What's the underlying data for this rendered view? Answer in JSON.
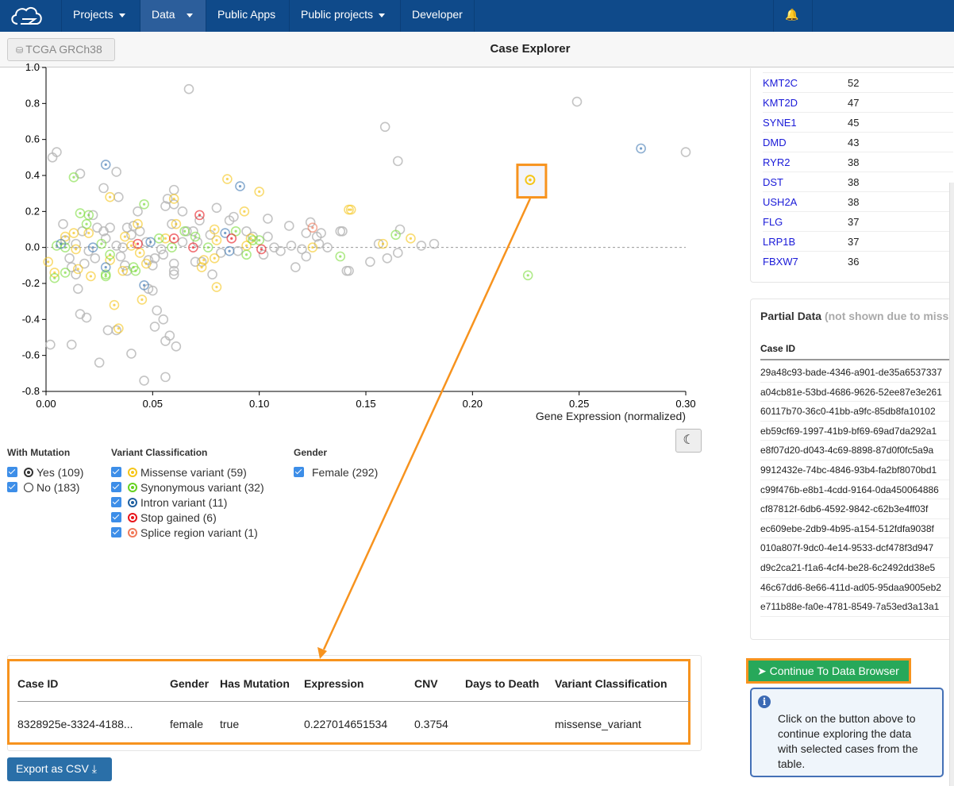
{
  "nav": {
    "items": [
      {
        "label": "Projects",
        "dropdown": true
      },
      {
        "label": "Data",
        "dropdown": true,
        "active": true
      },
      {
        "label": "Public Apps",
        "dropdown": false
      },
      {
        "label": "Public projects",
        "dropdown": true
      },
      {
        "label": "Developer",
        "dropdown": false
      }
    ],
    "bell_icon": "bell-icon"
  },
  "subheader": {
    "dataset_button": "TCGA GRCh38",
    "title": "Case Explorer"
  },
  "colors": {
    "nav_bg": "#0f4a8a",
    "highlight": "#f7931e",
    "continue": "#27a85a",
    "none": "#b5b5b5",
    "missense_variant": "#f5c518",
    "synonymous_variant": "#7bdc3c",
    "intron_variant": "#3f78b3",
    "stop_gained": "#e8141a",
    "splice_region_variant": "#f07a5a"
  },
  "chart_data": {
    "type": "scatter",
    "xlabel": "Gene Expression (normalized)",
    "xlim": [
      0,
      0.3
    ],
    "ylim": [
      -0.8,
      1.0
    ],
    "xticks": [
      "0.00",
      "0.05",
      "0.10",
      "0.15",
      "0.20",
      "0.25",
      "0.30"
    ],
    "yticks": [
      "-0.8",
      "-0.6",
      "-0.4",
      "-0.2",
      "0.0",
      "0.2",
      "0.4",
      "0.6",
      "0.8",
      "1.0"
    ],
    "reference_line_y": 0,
    "grid": false,
    "selected": {
      "x": 0.227014651534,
      "y": 0.3754,
      "class": "missense_variant"
    },
    "points": [
      [
        0.067,
        0.88,
        "none"
      ],
      [
        0.003,
        0.5,
        "none"
      ],
      [
        0.005,
        0.53,
        "none"
      ],
      [
        0.016,
        0.41,
        "none"
      ],
      [
        0.033,
        0.42,
        "none"
      ],
      [
        0.027,
        0.33,
        "none"
      ],
      [
        0.034,
        0.28,
        "none"
      ],
      [
        0.06,
        0.32,
        "none"
      ],
      [
        0.057,
        0.27,
        "none"
      ],
      [
        0.056,
        0.23,
        "none"
      ],
      [
        0.06,
        0.24,
        "none"
      ],
      [
        0.064,
        0.2,
        "none"
      ],
      [
        0.043,
        0.2,
        "none"
      ],
      [
        0.08,
        0.22,
        "none"
      ],
      [
        0.022,
        0.18,
        "none"
      ],
      [
        0.008,
        0.13,
        "none"
      ],
      [
        0.104,
        0.16,
        "none"
      ],
      [
        0.088,
        0.17,
        "none"
      ],
      [
        0.086,
        0.15,
        "none"
      ],
      [
        0.114,
        0.12,
        "none"
      ],
      [
        0.124,
        0.14,
        "none"
      ],
      [
        0.122,
        0.08,
        "none"
      ],
      [
        0.129,
        0.08,
        "none"
      ],
      [
        0.127,
        0.06,
        "none"
      ],
      [
        0.138,
        0.09,
        "none"
      ],
      [
        0.132,
        0.0,
        "none"
      ],
      [
        0.128,
        0.02,
        "none"
      ],
      [
        0.122,
        -0.05,
        "none"
      ],
      [
        0.117,
        -0.11,
        "none"
      ],
      [
        0.141,
        -0.13,
        "none"
      ],
      [
        0.12,
        -0.01,
        "none"
      ],
      [
        0.11,
        -0.02,
        "none"
      ],
      [
        0.115,
        0.01,
        "none"
      ],
      [
        0.107,
        0.0,
        "none"
      ],
      [
        0.104,
        0.06,
        "none"
      ],
      [
        0.102,
        -0.04,
        "none"
      ],
      [
        0.09,
        -0.02,
        "none"
      ],
      [
        0.078,
        -0.15,
        "none"
      ],
      [
        0.073,
        -0.08,
        "none"
      ],
      [
        0.07,
        -0.08,
        "none"
      ],
      [
        0.072,
        0.15,
        "none"
      ],
      [
        0.077,
        0.07,
        "none"
      ],
      [
        0.059,
        0.13,
        "none"
      ],
      [
        0.069,
        0.09,
        "none"
      ],
      [
        0.064,
        0.03,
        "none"
      ],
      [
        0.054,
        -0.01,
        "none"
      ],
      [
        0.055,
        -0.04,
        "none"
      ],
      [
        0.051,
        -0.06,
        "none"
      ],
      [
        0.05,
        -0.1,
        "none"
      ],
      [
        0.06,
        -0.09,
        "none"
      ],
      [
        0.06,
        -0.13,
        "none"
      ],
      [
        0.06,
        -0.15,
        "none"
      ],
      [
        0.048,
        -0.07,
        "none"
      ],
      [
        0.048,
        -0.23,
        "none"
      ],
      [
        0.05,
        -0.24,
        "none"
      ],
      [
        0.052,
        -0.35,
        "none"
      ],
      [
        0.055,
        -0.4,
        "none"
      ],
      [
        0.051,
        -0.44,
        "none"
      ],
      [
        0.058,
        -0.49,
        "none"
      ],
      [
        0.056,
        -0.52,
        "none"
      ],
      [
        0.061,
        -0.55,
        "none"
      ],
      [
        0.056,
        -0.72,
        "none"
      ],
      [
        0.046,
        -0.74,
        "none"
      ],
      [
        0.04,
        -0.59,
        "none"
      ],
      [
        0.025,
        -0.64,
        "none"
      ],
      [
        0.012,
        -0.54,
        "none"
      ],
      [
        0.002,
        -0.54,
        "none"
      ],
      [
        0.029,
        -0.46,
        "none"
      ],
      [
        0.033,
        -0.46,
        "none"
      ],
      [
        0.016,
        -0.37,
        "none"
      ],
      [
        0.019,
        -0.39,
        "none"
      ],
      [
        0.015,
        -0.23,
        "none"
      ],
      [
        0.012,
        -0.11,
        "none"
      ],
      [
        0.014,
        -0.15,
        "none"
      ],
      [
        0.011,
        -0.06,
        "none"
      ],
      [
        0.018,
        -0.09,
        "none"
      ],
      [
        0.017,
        0.09,
        "none"
      ],
      [
        0.024,
        0.11,
        "none"
      ],
      [
        0.027,
        0.09,
        "none"
      ],
      [
        0.03,
        0.11,
        "none"
      ],
      [
        0.028,
        0.05,
        "none"
      ],
      [
        0.038,
        0.11,
        "none"
      ],
      [
        0.041,
        0.12,
        "none"
      ],
      [
        0.04,
        0.07,
        "none"
      ],
      [
        0.044,
        0.09,
        "none"
      ],
      [
        0.033,
        0.01,
        "none"
      ],
      [
        0.036,
        0.0,
        "none"
      ],
      [
        0.035,
        -0.05,
        "none"
      ],
      [
        0.037,
        -0.1,
        "none"
      ],
      [
        0.038,
        -0.13,
        "none"
      ],
      [
        0.023,
        -0.06,
        "none"
      ],
      [
        0.02,
        -0.02,
        "none"
      ],
      [
        0.014,
        0.02,
        "none"
      ],
      [
        0.009,
        0.04,
        "none"
      ],
      [
        0.047,
        0.03,
        "none"
      ],
      [
        0.066,
        0.09,
        "none"
      ],
      [
        0.071,
        0.03,
        "none"
      ],
      [
        0.082,
        -0.03,
        "none"
      ],
      [
        0.097,
        0.06,
        "none"
      ],
      [
        0.094,
        0.09,
        "none"
      ],
      [
        0.249,
        0.81,
        "none"
      ],
      [
        0.159,
        0.67,
        "none"
      ],
      [
        0.165,
        0.48,
        "none"
      ],
      [
        0.3,
        0.53,
        "none"
      ],
      [
        0.139,
        0.09,
        "none"
      ],
      [
        0.166,
        0.1,
        "none"
      ],
      [
        0.156,
        0.02,
        "none"
      ],
      [
        0.176,
        0.01,
        "none"
      ],
      [
        0.182,
        0.02,
        "none"
      ],
      [
        0.165,
        -0.03,
        "none"
      ],
      [
        0.16,
        -0.06,
        "none"
      ],
      [
        0.152,
        -0.08,
        "none"
      ],
      [
        0.142,
        -0.13,
        "none"
      ],
      [
        0.085,
        0.38,
        "missense_variant"
      ],
      [
        0.1,
        0.31,
        "missense_variant"
      ],
      [
        0.093,
        0.2,
        "missense_variant"
      ],
      [
        0.142,
        0.21,
        "missense_variant"
      ],
      [
        0.03,
        0.28,
        "missense_variant"
      ],
      [
        0.06,
        0.27,
        "missense_variant"
      ],
      [
        0.061,
        0.13,
        "missense_variant"
      ],
      [
        0.043,
        0.13,
        "missense_variant"
      ],
      [
        0.013,
        0.08,
        "missense_variant"
      ],
      [
        0.009,
        0.06,
        "missense_variant"
      ],
      [
        0.02,
        0.08,
        "missense_variant"
      ],
      [
        0.037,
        0.06,
        "missense_variant"
      ],
      [
        0.056,
        0.05,
        "missense_variant"
      ],
      [
        0.079,
        0.1,
        "missense_variant"
      ],
      [
        0.08,
        0.04,
        "missense_variant"
      ],
      [
        0.001,
        -0.08,
        "missense_variant"
      ],
      [
        0.004,
        -0.14,
        "missense_variant"
      ],
      [
        0.021,
        -0.16,
        "missense_variant"
      ],
      [
        0.015,
        -0.12,
        "missense_variant"
      ],
      [
        0.032,
        -0.32,
        "missense_variant"
      ],
      [
        0.034,
        -0.45,
        "missense_variant"
      ],
      [
        0.045,
        -0.29,
        "missense_variant"
      ],
      [
        0.047,
        -0.09,
        "missense_variant"
      ],
      [
        0.044,
        -0.03,
        "missense_variant"
      ],
      [
        0.073,
        -0.11,
        "missense_variant"
      ],
      [
        0.08,
        -0.22,
        "missense_variant"
      ],
      [
        0.079,
        -0.06,
        "missense_variant"
      ],
      [
        0.094,
        0.01,
        "missense_variant"
      ],
      [
        0.125,
        0.0,
        "missense_variant"
      ],
      [
        0.014,
        -0.01,
        "missense_variant"
      ],
      [
        0.04,
        0.01,
        "missense_variant"
      ],
      [
        0.096,
        0.05,
        "missense_variant"
      ],
      [
        0.074,
        -0.07,
        "missense_variant"
      ],
      [
        0.03,
        -0.07,
        "missense_variant"
      ],
      [
        0.036,
        -0.13,
        "missense_variant"
      ],
      [
        0.143,
        0.21,
        "missense_variant"
      ],
      [
        0.158,
        0.02,
        "missense_variant"
      ],
      [
        0.171,
        0.05,
        "missense_variant"
      ],
      [
        0.013,
        0.39,
        "synonymous_variant"
      ],
      [
        0.046,
        0.24,
        "synonymous_variant"
      ],
      [
        0.016,
        0.19,
        "synonymous_variant"
      ],
      [
        0.02,
        0.18,
        "synonymous_variant"
      ],
      [
        0.019,
        0.13,
        "synonymous_variant"
      ],
      [
        0.005,
        0.01,
        "synonymous_variant"
      ],
      [
        0.009,
        0.0,
        "synonymous_variant"
      ],
      [
        0.004,
        -0.17,
        "synonymous_variant"
      ],
      [
        0.009,
        -0.14,
        "synonymous_variant"
      ],
      [
        0.028,
        -0.15,
        "synonymous_variant"
      ],
      [
        0.028,
        -0.16,
        "synonymous_variant"
      ],
      [
        0.041,
        -0.11,
        "synonymous_variant"
      ],
      [
        0.042,
        -0.13,
        "synonymous_variant"
      ],
      [
        0.03,
        -0.04,
        "synonymous_variant"
      ],
      [
        0.053,
        0.05,
        "synonymous_variant"
      ],
      [
        0.059,
        0.0,
        "synonymous_variant"
      ],
      [
        0.065,
        0.09,
        "synonymous_variant"
      ],
      [
        0.07,
        0.06,
        "synonymous_variant"
      ],
      [
        0.076,
        0.0,
        "synonymous_variant"
      ],
      [
        0.089,
        0.09,
        "synonymous_variant"
      ],
      [
        0.094,
        -0.04,
        "synonymous_variant"
      ],
      [
        0.097,
        0.04,
        "synonymous_variant"
      ],
      [
        0.1,
        0.04,
        "synonymous_variant"
      ],
      [
        0.138,
        -0.05,
        "synonymous_variant"
      ],
      [
        0.026,
        0.02,
        "synonymous_variant"
      ],
      [
        0.164,
        0.07,
        "synonymous_variant"
      ],
      [
        0.226,
        -0.155,
        "synonymous_variant"
      ],
      [
        0.028,
        0.46,
        "intron_variant"
      ],
      [
        0.091,
        0.34,
        "intron_variant"
      ],
      [
        0.007,
        0.02,
        "intron_variant"
      ],
      [
        0.022,
        0.0,
        "intron_variant"
      ],
      [
        0.049,
        0.03,
        "intron_variant"
      ],
      [
        0.084,
        0.08,
        "intron_variant"
      ],
      [
        0.086,
        -0.02,
        "intron_variant"
      ],
      [
        0.028,
        -0.11,
        "intron_variant"
      ],
      [
        0.046,
        -0.21,
        "intron_variant"
      ],
      [
        0.279,
        0.55,
        "intron_variant"
      ],
      [
        0.072,
        0.18,
        "stop_gained"
      ],
      [
        0.043,
        0.02,
        "stop_gained"
      ],
      [
        0.06,
        0.05,
        "stop_gained"
      ],
      [
        0.069,
        0.0,
        "stop_gained"
      ],
      [
        0.087,
        0.05,
        "stop_gained"
      ],
      [
        0.101,
        -0.01,
        "stop_gained"
      ],
      [
        0.125,
        0.11,
        "splice_region_variant"
      ]
    ]
  },
  "legend": {
    "mutation": {
      "title": "With Mutation",
      "items": [
        {
          "label": "Yes (109)",
          "dot": true
        },
        {
          "label": "No (183)",
          "dot": false
        }
      ]
    },
    "variant": {
      "title": "Variant Classification",
      "items": [
        {
          "label": "Missense variant (59)",
          "key": "missense_variant"
        },
        {
          "label": "Synonymous variant (32)",
          "key": "synonymous_variant"
        },
        {
          "label": "Intron variant (11)",
          "key": "intron_variant"
        },
        {
          "label": "Stop gained (6)",
          "key": "stop_gained"
        },
        {
          "label": "Splice region variant (1)",
          "key": "splice_region_variant"
        }
      ]
    },
    "gender": {
      "title": "Gender",
      "items": [
        {
          "label": "Female (292)"
        }
      ]
    }
  },
  "theme_toggle_icon": "moon-icon",
  "genes": [
    {
      "gene": "KMT2C",
      "count": "52"
    },
    {
      "gene": "KMT2D",
      "count": "47"
    },
    {
      "gene": "SYNE1",
      "count": "45"
    },
    {
      "gene": "DMD",
      "count": "43"
    },
    {
      "gene": "RYR2",
      "count": "38"
    },
    {
      "gene": "DST",
      "count": "38"
    },
    {
      "gene": "USH2A",
      "count": "38"
    },
    {
      "gene": "FLG",
      "count": "37"
    },
    {
      "gene": "LRP1B",
      "count": "37"
    },
    {
      "gene": "FBXW7",
      "count": "36"
    }
  ],
  "partial": {
    "title": "Partial Data",
    "subtitle": "(not shown due to missi",
    "header": "Case ID",
    "rows": [
      "29a48c93-bade-4346-a901-de35a6537337",
      "a04cb81e-53bd-4686-9626-52ee87e3e261",
      "60117b70-36c0-41bb-a9fc-85db8fa10102",
      "eb59cf69-1997-41b9-bf69-69ad7da292a1",
      "e8f07d20-d043-4c69-8898-87d0f0fc5a9a",
      "9912432e-74bc-4846-93b4-fa2bf8070bd1",
      "c99f476b-e8b1-4cdd-9164-0da450064886",
      "cf87812f-6db6-4592-9842-c62b3e4ff03f",
      "ec609ebe-2db9-4b95-a154-512fdfa9038f",
      "010a807f-9dc0-4e14-9533-dcf478f3d947",
      "d9c2ca21-f1a6-4cf4-be28-6c2492dd38e5",
      "46c67dd6-8e66-411d-ad05-95daa9005eb2",
      "e711b88e-fa0e-4781-8549-7a53ed3a13a1"
    ]
  },
  "selected_table": {
    "headers": [
      "Case ID",
      "Gender",
      "Has Mutation",
      "Expression",
      "CNV",
      "Days to Death",
      "Variant Classification"
    ],
    "row": [
      "8328925e-3324-4188...",
      "female",
      "true",
      "0.227014651534",
      "0.3754",
      "",
      "missense_variant"
    ]
  },
  "continue_button": "Continue To Data Browser",
  "info_text": "Click on the button above to continue exploring the data with selected cases from the table.",
  "export_button": "Export as CSV"
}
